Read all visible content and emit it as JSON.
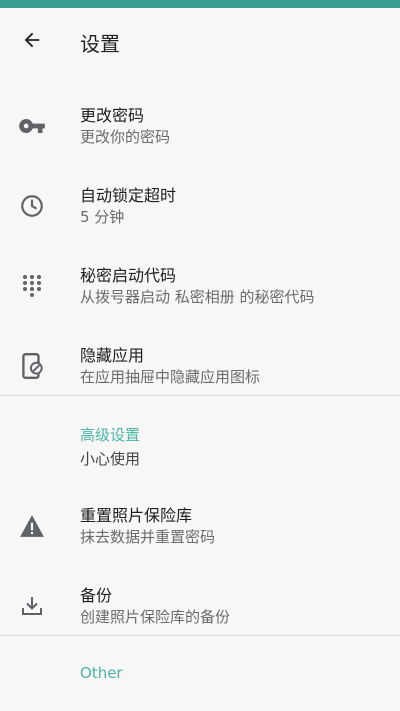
{
  "colors": {
    "accent": "#4cb5a8",
    "status_bar": "#3b9c91",
    "icon": "#5f6368"
  },
  "header": {
    "title": "设置",
    "back_icon": "arrow-left-icon"
  },
  "items": [
    {
      "title": "更改密码",
      "subtitle": "更改你的密码",
      "icon": "key-icon"
    },
    {
      "title": "自动锁定超时",
      "subtitle": "5 分钟",
      "icon": "clock-icon"
    },
    {
      "title": "秘密启动代码",
      "subtitle": "从拨号器启动 私密相册 的秘密代码",
      "icon": "dialpad-icon"
    },
    {
      "title": "隐藏应用",
      "subtitle": "在应用抽屉中隐藏应用图标",
      "icon": "phone-hide-icon"
    }
  ],
  "advanced": {
    "title": "高级设置",
    "subtitle": "小心使用",
    "items": [
      {
        "title": "重置照片保险库",
        "subtitle": "抹去数据并重置密码",
        "icon": "warning-icon"
      },
      {
        "title": "备份",
        "subtitle": "创建照片保险库的备份",
        "icon": "download-icon"
      }
    ]
  },
  "other": {
    "title": "Other"
  }
}
